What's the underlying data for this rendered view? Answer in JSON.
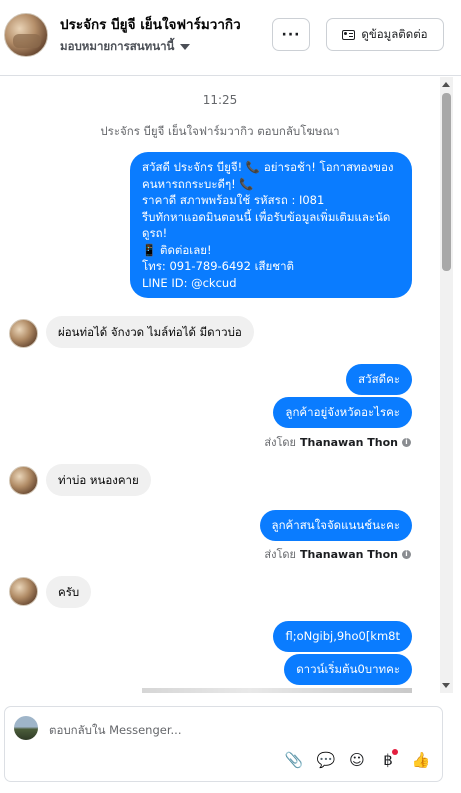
{
  "header": {
    "page_name": "ประจักร บียูจี เย็นใจฟาร์มวากิว",
    "assignee": "มอบหมายการสนทนานี้",
    "more_label": "···",
    "contact_button": "ดูข้อมูลติดต่อ"
  },
  "thread": {
    "timestamp": "11:25",
    "system_note": "ประจักร บียูจี เย็นใจฟาร์มวากิว ตอบกลับโฆษณา",
    "ad_message_lines": [
      "สวัสดี ประจักร บียูจี! 📞 อย่ารอช้า! โอกาสทองของ",
      "คนหารถกระบะดีๆ! 📞",
      "ราคาดี สภาพพร้อมใช้ รหัสรถ : I081",
      "รีบทักหาแอดมินตอนนี้ เพื่อรับข้อมูลเพิ่มเติมและนัด",
      "ดูรถ!",
      "📱 ติดต่อเลย!",
      "โทร: 091-789-6492 เสียชาติ",
      "LINE ID: @ckcud"
    ],
    "messages": [
      {
        "dir": "in",
        "text": "ผ่อนท่อได้ จักงวด ไมล์ท่อได้ มีดาวบ่อ"
      },
      {
        "dir": "out",
        "text": "สวัสดีคะ"
      },
      {
        "dir": "out",
        "text": "ลูกค้าอยู่จังหวัดอะไรคะ"
      },
      {
        "dir": "in",
        "text": "ท่าบ่อ หนองคาย"
      },
      {
        "dir": "out",
        "text": "ลูกค้าสนใจจัดแนนช์นะคะ"
      },
      {
        "dir": "in",
        "text": "ครับ"
      },
      {
        "dir": "out",
        "text": "fl;oNgibj,9ho0[km8t"
      },
      {
        "dir": "out",
        "text": "ดาวน์เริ่มต้น0บาทคะ"
      }
    ],
    "sent_by_prefix": "ส่งโดย",
    "sent_by_name": "Thanawan Thon",
    "info_icon": "i"
  },
  "composer": {
    "placeholder": "ตอบกลับใน Messenger...",
    "tools": [
      "attach-icon",
      "comment-icon",
      "emoji-icon",
      "baht-icon",
      "like-icon"
    ],
    "tool_glyphs": {
      "attach": "📎",
      "comment": "💬",
      "emoji": "☺",
      "baht": "฿",
      "like": "👍"
    }
  },
  "colors": {
    "outgoing_bubble": "#0a7cff",
    "incoming_bubble": "#f0f0f0",
    "notification_dot": "#e41e3f"
  }
}
